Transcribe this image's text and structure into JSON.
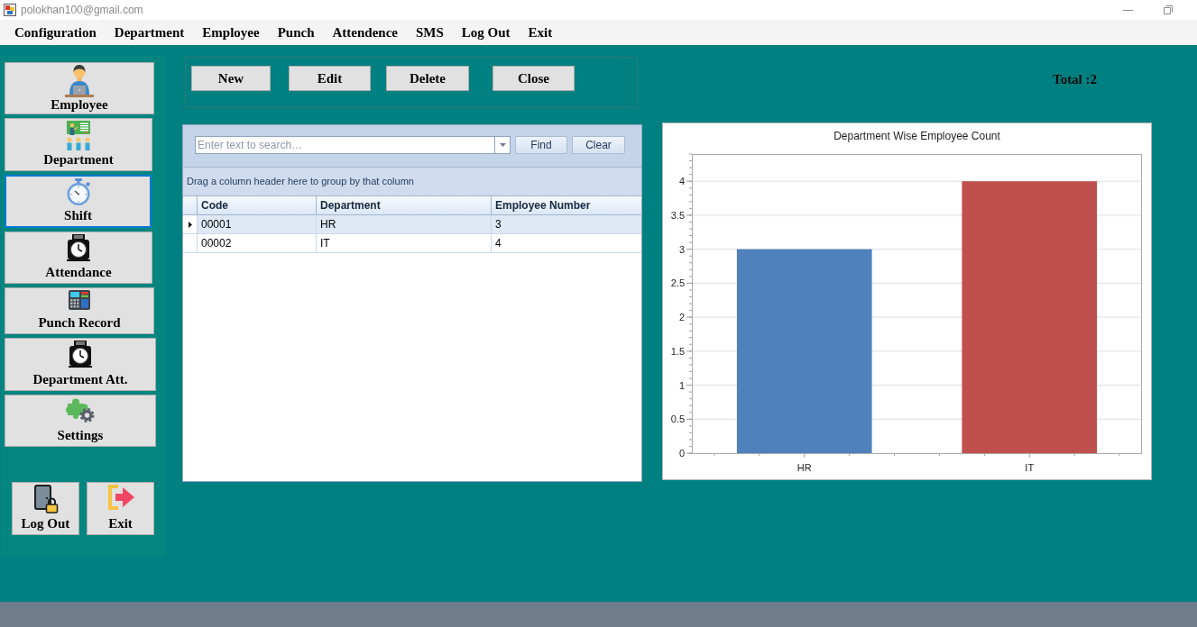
{
  "window": {
    "title": "polokhan100@gmail.com"
  },
  "menu": {
    "items": [
      "Configuration",
      "Department",
      "Employee",
      "Punch",
      "Attendence",
      "SMS",
      "Log Out",
      "Exit"
    ]
  },
  "sidebar": {
    "items": [
      {
        "label": "Employee",
        "selected": false
      },
      {
        "label": "Department",
        "selected": false
      },
      {
        "label": "Shift",
        "selected": true
      },
      {
        "label": "Attendance",
        "selected": false
      },
      {
        "label": "Punch Record",
        "selected": false
      },
      {
        "label": "Department Att.",
        "selected": false
      },
      {
        "label": "Settings",
        "selected": false
      }
    ],
    "bottom_buttons": [
      "Log Out",
      "Exit"
    ]
  },
  "toolbar": {
    "buttons": [
      "New",
      "Edit",
      "Delete",
      "Close"
    ],
    "total": "Total :2"
  },
  "grid": {
    "search": {
      "placeholder": "Enter text to search…"
    },
    "buttons": [
      "Find",
      "Clear"
    ],
    "group_hint": "Drag a column header here to group by that column",
    "columns": [
      "Code",
      "Department",
      "Employee Number"
    ],
    "rows": [
      {
        "cells": [
          "00001",
          "HR",
          "3"
        ],
        "selected": true
      },
      {
        "cells": [
          "00002",
          "IT",
          "4"
        ],
        "selected": false
      }
    ]
  },
  "chart": {
    "chart_data": {
      "type": "bar",
      "title": "Department Wise Employee Count",
      "categories": [
        "HR",
        "IT"
      ],
      "values": [
        3,
        4
      ],
      "colors": [
        "#4f81bd",
        "#c0504d"
      ],
      "ylim": [
        0,
        4.4
      ],
      "yticks": [
        0,
        0.5,
        1,
        1.5,
        2,
        2.5,
        3,
        3.5,
        4
      ],
      "grid": true
    }
  }
}
